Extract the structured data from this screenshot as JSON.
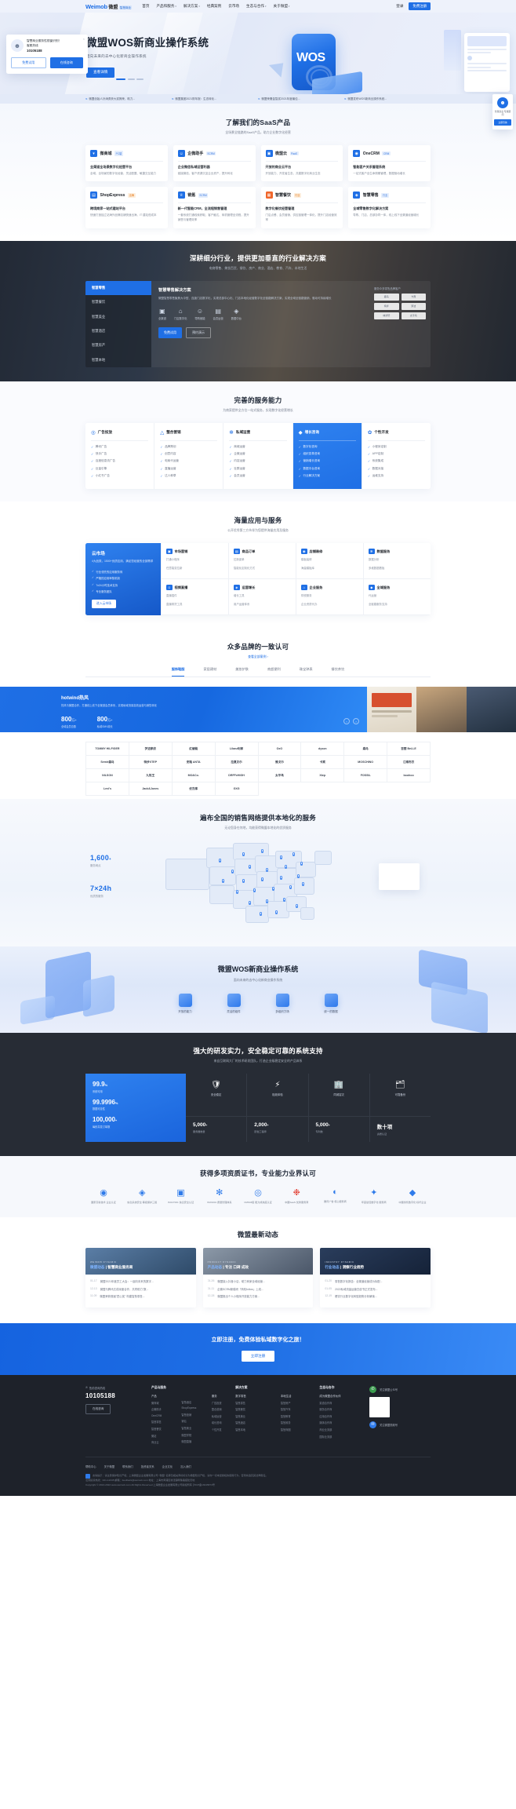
{
  "nav": {
    "logo_mark": "Weimob",
    "logo_cn": "微盟",
    "logo_badge": "智慧商业\n服务商",
    "items": [
      {
        "label": "首页",
        "caret": ""
      },
      {
        "label": "产品和服务",
        "caret": "▾"
      },
      {
        "label": "解决方案",
        "caret": "▾"
      },
      {
        "label": "经典案例",
        "caret": ""
      },
      {
        "label": "云市场",
        "caret": ""
      },
      {
        "label": "生态与合作",
        "caret": "▾"
      },
      {
        "label": "关于微盟",
        "caret": "▾"
      }
    ],
    "login": "登录",
    "cta": "免费注册"
  },
  "hero": {
    "title": "微盟WOS新商业操作系统",
    "subtitle": "面向未来的去中心化新商业操作系统",
    "button": "查看详情",
    "wos_logo": "WOS"
  },
  "ticker": [
    {
      "text": "微盟创始人孙涛勇获大奖殊荣，助力..."
    },
    {
      "text": "微盟集团2021财年报：生态转化..."
    },
    {
      "text": "微盟荣膺金智奖2021年度最佳..."
    },
    {
      "text": "微盟发布WOS新商业操作系统..."
    }
  ],
  "consult": {
    "title": "智慧商业服务性视窗识别！",
    "phone_label": "客服热线",
    "phone": "10105188",
    "btn_ghost": "免费试用",
    "btn_fill": "在线咨询",
    "close": "×"
  },
  "float_widget": {
    "title": "智慧商业\n专属顾问",
    "button": "立即咨询"
  },
  "saas": {
    "title": "了解我们的SaaS产品",
    "subtitle": "全场景全链路的SaaS产品，助力企业数字化经营",
    "products": [
      {
        "icon": "▾",
        "name": "微商城",
        "tag": "PC端",
        "tag_type": "blue",
        "heading": "全渠道全场景数字化经营平台",
        "desc": "全域、全场景的数字化经营，灵活配置、敏捷交互能力"
      },
      {
        "icon": "☺",
        "name": "企微助手",
        "tag": "SCRM",
        "tag_type": "blue",
        "heading": "企业微信私域运营利器",
        "desc": "链接微信、客户资源沉淀企业资产，提升转化"
      },
      {
        "icon": "▣",
        "name": "微盟云",
        "tag": "PaaS",
        "tag_type": "blue",
        "heading": "开放的商业云平台",
        "desc": "开放能力、开发者生态，共建数字化商业生态"
      },
      {
        "icon": "◉",
        "name": "OneCRM",
        "tag": "CRM",
        "tag_type": "blue",
        "heading": "智能客户关系管理系统",
        "desc": "一站式客户全生命周期管理，数据驱动增长"
      },
      {
        "icon": "▤",
        "name": "ShopExpress",
        "tag": "出海",
        "tag_type": "or",
        "heading": "跨境商家一站式建站平台",
        "desc": "快速打造独立站海外品牌店铺快速出海，IT 建站低成本"
      },
      {
        "icon": "♕",
        "name": "销氪",
        "tag": "SCRM",
        "tag_type": "blue",
        "heading": "新一代智能CRM，全流程销售管理",
        "desc": "一套系统打通线索获取、客户触达、商机管理全流程，提升销售与管理效率"
      },
      {
        "icon": "▦",
        "name": "智慧餐饮",
        "tag": "行业",
        "tag_type": "or",
        "heading": "数字化餐饮经营管理",
        "desc": "门店点餐、会员营销、供应链管理一体化，提升门店经营效率"
      },
      {
        "icon": "◈",
        "name": "智慧零售",
        "tag": "行业",
        "tag_type": "blue",
        "heading": "全域零售数字化解决方案",
        "desc": "导购、门店、总部协同一体，线上线下全渠道经营增长"
      }
    ]
  },
  "industry": {
    "title": "深耕细分行业，提供更加垂直的行业解决方案",
    "subtitle": "电商零售、美妆百货、餐饮、房产、商业、酒店、教育、汽车、本地生活",
    "tabs": [
      {
        "label": "智慧零售",
        "active": true
      },
      {
        "label": "智慧餐饮",
        "active": false
      },
      {
        "label": "智慧美业",
        "active": false
      },
      {
        "label": "智慧酒店",
        "active": false
      },
      {
        "label": "智慧房产",
        "active": false
      },
      {
        "label": "智慧本地",
        "active": false
      }
    ],
    "heading": "智慧零售解决方案",
    "desc": "微盟智慧零售聚焦大中型、连锁门店数字化，实现总部中心化、门店本地化经营数字化全链路解决方案，实现全域全链路营销，驱动可持续增长",
    "features": [
      {
        "icon": "▣",
        "label": "全渠道"
      },
      {
        "icon": "⌂",
        "label": "门店数字化"
      },
      {
        "icon": "☺",
        "label": "导购赋能"
      },
      {
        "icon": "▤",
        "label": "会员运营"
      },
      {
        "icon": "◈",
        "label": "数据中台"
      }
    ],
    "btn_fill": "免费试用",
    "btn_ghost": "预约演示",
    "side_title": "服务众多零售品牌客户",
    "side_logos": [
      "森马",
      "卡宾",
      "特步",
      "梦洁",
      "林清轩",
      "太平鸟"
    ]
  },
  "service": {
    "title": "完善的服务能力",
    "subtitle": "为商家提供全方位一站式服务，实现数字化经营增长",
    "columns": [
      {
        "icon": "◎",
        "name": "广告投放",
        "active": false,
        "items": [
          "腾讯广告",
          "快手广告",
          "百度信息流广告",
          "巨量引擎",
          "小红书广告"
        ]
      },
      {
        "icon": "△",
        "name": "整合营销",
        "active": false,
        "items": [
          "品牌策划",
          "创意内容",
          "电商代运营",
          "直播运营",
          "达人种草"
        ]
      },
      {
        "icon": "✻",
        "name": "私域运营",
        "active": false,
        "items": [
          "商城运营",
          "企微运营",
          "内容运营",
          "社群运营",
          "会员运营"
        ]
      },
      {
        "icon": "◆",
        "name": "增长咨询",
        "active": true,
        "items": [
          "数字化咨询",
          "组织变革咨询",
          "营销增长咨询",
          "数据中台咨询",
          "行业解决方案"
        ]
      },
      {
        "icon": "✿",
        "name": "个性开发",
        "active": false,
        "items": [
          "小程序定制",
          "APP定制",
          "系统集成",
          "数据对接",
          "运维支持"
        ]
      }
    ]
  },
  "appmarket": {
    "title": "海量应用与服务",
    "subtitle": "公开优秀第三方伙伴为您提供海量应用及服务",
    "left": {
      "title": "云市场",
      "desc": "4大品类，1500+优质应用，满足您经营的全部需求",
      "items": [
        "行业领先的应用服务商",
        "严格的应用审核机制",
        "7x24小时技术支持",
        "专业服务团队"
      ],
      "button": "进入云市场"
    },
    "cells": [
      {
        "icon": "▣",
        "name": "市场营销",
        "lines": [
          "打通小程序",
          "任意裂变拉新"
        ]
      },
      {
        "icon": "▤",
        "name": "商品订单",
        "lines": [
          "拉新促单",
          "智能化定制化方式"
        ]
      },
      {
        "icon": "◉",
        "name": "店铺装修",
        "lines": [
          "模板装修",
          "海量模板库"
        ]
      },
      {
        "icon": "✻",
        "name": "数据服务",
        "lines": [
          "数据分析",
          "多维数据看板"
        ]
      },
      {
        "icon": "☺",
        "name": "视频直播",
        "lines": [
          "直播插件",
          "直播带货工具"
        ]
      },
      {
        "icon": "◈",
        "name": "运营增长",
        "lines": [
          "增长工具",
          "用户运营体系"
        ]
      },
      {
        "icon": "⌂",
        "name": "企业服务",
        "lines": [
          "财税服务",
          "企业资质代办"
        ]
      },
      {
        "icon": "◆",
        "name": "全域服务",
        "lines": [
          "代运营",
          "全链路服务支持"
        ]
      }
    ]
  },
  "cases": {
    "title": "众多品牌的一致认可",
    "subtitle_link": "查看全部案例 ›",
    "tabs": [
      {
        "label": "服饰鞋服",
        "active": true
      },
      {
        "label": "家居建材",
        "active": false
      },
      {
        "label": "美妆护肤",
        "active": false
      },
      {
        "label": "商超便利",
        "active": false
      },
      {
        "label": "珠宝钟表",
        "active": false
      },
      {
        "label": "餐饮茶饮",
        "active": false
      }
    ],
    "featured": {
      "brand": "hotwind热风",
      "desc": "热风与微盟合作，打通线上线下全渠道会员体系，实现私域流量高效运营与销售转化",
      "stats": [
        {
          "value": "800",
          "unit": "万+",
          "label": "全域会员总数"
        },
        {
          "value": "800",
          "unit": "万+",
          "label": "私域GMV增长"
        }
      ],
      "prev": "‹",
      "next": "›"
    },
    "logos": [
      "TOMMY HILFIGER",
      "梦洁家纺",
      "红蜻蜓",
      "Lilanz利郎",
      "OxO",
      "dyson",
      "森马",
      "百丽 BeLLE",
      "Semir森马",
      "特步XTEP",
      "安踏 ANTA",
      "拉夏贝尔",
      "雅戈尔",
      "卡宾",
      "MOSCHINO",
      "江南布衣",
      "NILSON",
      "九牧王",
      "MO&Co.",
      "DRFFeHIGH",
      "太平鸟",
      "Xtep",
      "FOSSIL",
      "boohoo",
      "Levi's",
      "Jack&Jones",
      "优衣库",
      "GXG"
    ]
  },
  "map": {
    "title": "遍布全国的销售网络提供本地化的服务",
    "subtitle": "无论您身在何地，均能获得微盟本地化的优质服务",
    "stats": [
      {
        "value": "1,600",
        "unit": "+",
        "label": "服务网点"
      },
      {
        "value": "7×24h",
        "unit": "",
        "label": "优质的服务"
      }
    ]
  },
  "wos_iso": {
    "title": "微盟WOS新商业操作系统",
    "subtitle": "面向未来的去中心化新商业操作系统",
    "features": [
      {
        "label": "开放的能力"
      },
      {
        "label": "灵活的组件"
      },
      {
        "label": "多组织力场"
      },
      {
        "label": "统一的数据"
      }
    ]
  },
  "tech": {
    "title": "强大的研发实力，安全稳定可靠的系统支持",
    "subtitle": "来自互联网大厂的技术研发团队，打造企业级稳定安全的产品体系",
    "left_stats": [
      {
        "value": "99.9",
        "unit": "%",
        "label": "系统可用"
      },
      {
        "value": "99.9996",
        "unit": "%",
        "label": "数据可靠性"
      },
      {
        "value": "100,000",
        "unit": "+",
        "label": "每秒并发订单数"
      }
    ],
    "icons": [
      {
        "icon": "🛡",
        "label": "安全稳定"
      },
      {
        "icon": "⚡",
        "label": "极致体验"
      },
      {
        "icon": "🏢",
        "label": "同城容灾"
      },
      {
        "icon": "🗂",
        "label": "可靠备份"
      }
    ],
    "nums": [
      {
        "value": "5,000",
        "unit": "+",
        "label": "服务器数量"
      },
      {
        "value": "2,000",
        "unit": "+",
        "label": "研发工程师"
      },
      {
        "value": "5,000",
        "unit": "+",
        "label": "专利数"
      },
      {
        "value": "数十项",
        "unit": "",
        "label": "资质认证"
      }
    ]
  },
  "certs": {
    "title": "获得多项资质证书，专业能力业界认可",
    "items": [
      {
        "label": "国家高新技术\n企业认证"
      },
      {
        "label": "信息系统安全\n等级保护三级"
      },
      {
        "label": "ISO27001\n信息安全认证"
      },
      {
        "label": "ISO9001\n质量管理体系"
      },
      {
        "label": "CMMI3级\n能力成熟度认证"
      },
      {
        "label": "中国SaaS\n优秀服务商"
      },
      {
        "label": "腾讯广告\n核心服务商"
      },
      {
        "label": "年度最佳数字化\n服务商"
      },
      {
        "label": "中国零售数字化\n标杆企业"
      }
    ]
  },
  "news": {
    "title": "微盟最新动态",
    "cards": [
      {
        "kicker": "WEIMOB DYNAMIC",
        "heading": "微盟动态",
        "heading_sub": "智慧商业服务商",
        "items": [
          {
            "date": "01-17",
            "text": "微盟2021年度员工大会：一起向未来的数字..."
          },
          {
            "date": "12-13",
            "text": "微盟与腾讯达成深度合作，共同助力\"数..."
          },
          {
            "date": "11-09",
            "text": "微盟荣获首届\"匠心奖\" 构建智慧零售..."
          }
        ]
      },
      {
        "kicker": "PRODUCT DYNAMIC",
        "heading": "产品动态",
        "heading_sub": "专注 口碑 成效",
        "items": [
          {
            "date": "01-26",
            "text": "微盟接入抖音小店，助力商家全域经营..."
          },
          {
            "date": "01-11",
            "text": "企微SCRM新模块「商机follow」上线..."
          },
          {
            "date": "12-28",
            "text": "微盟推出个人小程序开放能力方案..."
          }
        ]
      },
      {
        "kicker": "INDUSTRY DYNAMIC",
        "heading": "行业动态",
        "heading_sub": "洞察行业趋势",
        "items": [
          {
            "date": "01-20",
            "text": "零售数字化报告：全渠道经营成为标配..."
          },
          {
            "date": "01-05",
            "text": "2022私域流量运营白皮书正式发布..."
          },
          {
            "date": "12-19",
            "text": "餐饮行业数字化转型趋势分析解读..."
          }
        ]
      }
    ]
  },
  "cta": {
    "title": "立即注册，免费体验私域数字化之旅！",
    "button": "立即注册"
  },
  "footer": {
    "contact_label": "售前咨询热线",
    "phone": "10105188",
    "button": "在线咨询",
    "columns": [
      {
        "title": "产品与服务",
        "subs": [
          {
            "title": "产品",
            "items": [
              "微商城",
              "企微助手",
              "OneCRM",
              "智慧零售",
              "智慧餐饮",
              "微站",
              "商业云"
            ]
          },
          {
            "title": "",
            "items": [
              "智慧酒店",
              "ShopExpress",
              "智慧营销",
              "销氪",
              "智慧美业",
              "微盟学院",
              "微盟直播"
            ]
          },
          {
            "title": "服务",
            "items": [
              "广告投放",
              "整合营销",
              "私域运营",
              "增长咨询",
              "个性开发"
            ]
          }
        ]
      },
      {
        "title": "解决方案",
        "subs": [
          {
            "title": "数字零售",
            "items": [
              "智慧零售",
              "智慧餐饮",
              "智慧美业",
              "智慧酒店",
              "智慧本地"
            ]
          },
          {
            "title": "本地生活",
            "items": [
              "智慧房产",
              "智慧汽车",
              "智慧教育",
              "智慧政务",
              "智慧商圈"
            ]
          }
        ]
      },
      {
        "title": "生态与合作",
        "subs": [
          {
            "title": "成为微盟合作伙伴",
            "items": [
              "渠道合作商",
              "服务合作商",
              "应用合作商",
              "媒体合作商",
              "商业业务部",
              "国际业务部"
            ]
          }
        ]
      }
    ],
    "qr": [
      {
        "icon": "✆",
        "title": "关注微盟公众号"
      },
      {
        "icon": "✉",
        "title": "关注微盟视频号"
      }
    ],
    "links": [
      "帮助中心",
      "关于微盟",
      "联系我们",
      "投资者关系",
      "企业文化",
      "加入我们"
    ],
    "legal_notice": "友情提示：请注意保护知识产权，上海微盟企业发展有限公司 \"微盟\" 名称及相关商标标识为微盟知识产权，请勿一切未经授权的使用行为，否则将追究其法律责任。",
    "legal_line2": "法务投诉热线：021-12345    邮箱：feedback@weimob.com    地址：上海市青浦区徐泾镇明珠路搭建天地",
    "copyright": "Copyright © 2013-2022 www.weimob.com All Rights Reserved  上海微盟企业发展有限公司版权所有  沪ICP备13045873号"
  }
}
